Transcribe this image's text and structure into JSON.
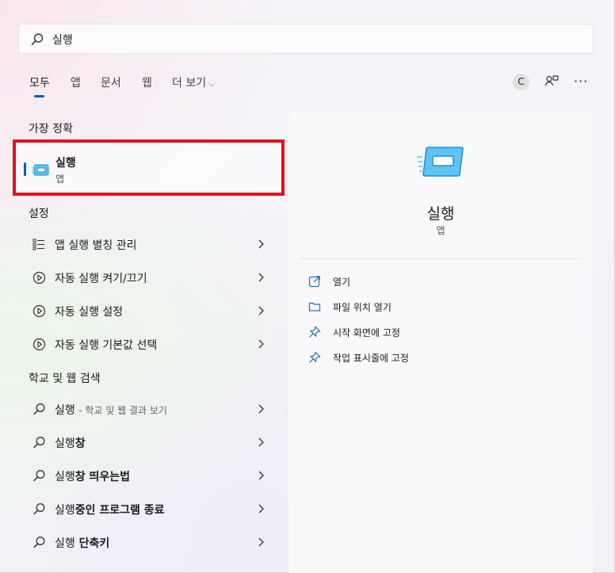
{
  "search": {
    "query": "실행"
  },
  "tabs": [
    {
      "label": "모두"
    },
    {
      "label": "앱"
    },
    {
      "label": "문서"
    },
    {
      "label": "웹"
    },
    {
      "label": "더 보기"
    }
  ],
  "header": {
    "avatar_initial": "C",
    "more": "···"
  },
  "best_match": {
    "section": "가장 정확",
    "name": "실행",
    "type": "앱"
  },
  "settings": {
    "section": "설정",
    "items": [
      {
        "label": "앱 실행 별칭 관리"
      },
      {
        "label": "자동 실행 켜기/끄기"
      },
      {
        "label": "자동 실행 설정"
      },
      {
        "label": "자동 실행 기본값 선택"
      }
    ]
  },
  "web": {
    "section": "학교 및 웹 검색",
    "items": [
      {
        "query": "실행",
        "suffix": "- 학교 및 웹 결과 보기"
      },
      {
        "prefix": "실행",
        "bold": "창"
      },
      {
        "prefix": "실행",
        "bold": "창 띄우는법"
      },
      {
        "prefix": "실행",
        "bold": "중인 프로그램 종료"
      },
      {
        "prefix": "실행",
        "bold": " 단축키"
      }
    ]
  },
  "detail": {
    "title": "실행",
    "subtitle": "앱",
    "actions": [
      {
        "label": "열기",
        "icon": "open-icon"
      },
      {
        "label": "파일 위치 열기",
        "icon": "folder-icon"
      },
      {
        "label": "시작 화면에 고정",
        "icon": "pin-icon"
      },
      {
        "label": "작업 표시줄에 고정",
        "icon": "pin-icon"
      }
    ]
  },
  "colors": {
    "accent": "#005fb8",
    "highlight_border": "#e3111f"
  }
}
